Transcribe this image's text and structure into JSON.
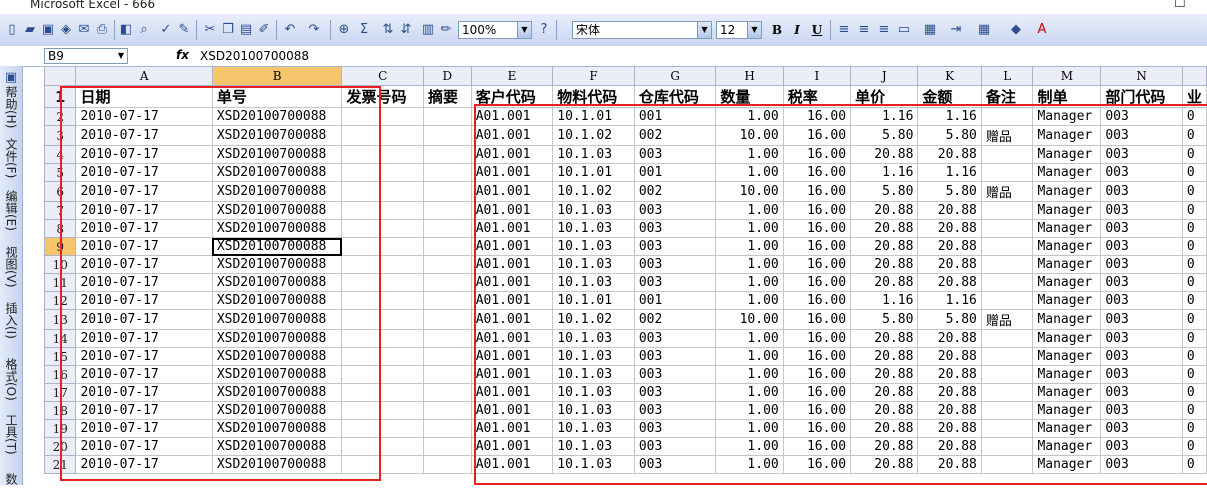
{
  "window": {
    "title": "Microsoft Excel - 666",
    "maximize_glyph": "☐"
  },
  "toolbar": {
    "zoom": "100%",
    "font_name": "宋体",
    "font_size": "12",
    "bold": "B",
    "italic": "I",
    "underline": "U"
  },
  "formula_bar": {
    "name_box": "B9",
    "fx": "fx",
    "content": "XSD20100700088"
  },
  "side_menu": [
    "帮助(H)",
    "文件(F)",
    "编辑(E)",
    "视图(V)",
    "插入(I)",
    "格式(O)",
    "工具(T)",
    "数据(D)"
  ],
  "sheet": {
    "columns": [
      "A",
      "B",
      "C",
      "D",
      "E",
      "F",
      "G",
      "H",
      "I",
      "J",
      "K",
      "L",
      "M",
      "N",
      ""
    ],
    "header_row": [
      "日期",
      "单号",
      "发票号码",
      "摘要",
      "客户代码",
      "物料代码",
      "仓库代码",
      "数量",
      "税率",
      "单价",
      "金额",
      "备注",
      "制单",
      "部门代码",
      "业"
    ],
    "rows": [
      [
        "2",
        "2010-07-17",
        "XSD20100700088",
        "",
        "",
        "A01.001",
        "10.1.01",
        "001",
        "1.00",
        "16.00",
        "1.16",
        "1.16",
        "",
        "Manager",
        "003",
        "0"
      ],
      [
        "3",
        "2010-07-17",
        "XSD20100700088",
        "",
        "",
        "A01.001",
        "10.1.02",
        "002",
        "10.00",
        "16.00",
        "5.80",
        "5.80",
        "赠品",
        "Manager",
        "003",
        "0"
      ],
      [
        "4",
        "2010-07-17",
        "XSD20100700088",
        "",
        "",
        "A01.001",
        "10.1.03",
        "003",
        "1.00",
        "16.00",
        "20.88",
        "20.88",
        "",
        "Manager",
        "003",
        "0"
      ],
      [
        "5",
        "2010-07-17",
        "XSD20100700088",
        "",
        "",
        "A01.001",
        "10.1.01",
        "001",
        "1.00",
        "16.00",
        "1.16",
        "1.16",
        "",
        "Manager",
        "003",
        "0"
      ],
      [
        "6",
        "2010-07-17",
        "XSD20100700088",
        "",
        "",
        "A01.001",
        "10.1.02",
        "002",
        "10.00",
        "16.00",
        "5.80",
        "5.80",
        "赠品",
        "Manager",
        "003",
        "0"
      ],
      [
        "7",
        "2010-07-17",
        "XSD20100700088",
        "",
        "",
        "A01.001",
        "10.1.03",
        "003",
        "1.00",
        "16.00",
        "20.88",
        "20.88",
        "",
        "Manager",
        "003",
        "0"
      ],
      [
        "8",
        "2010-07-17",
        "XSD20100700088",
        "",
        "",
        "A01.001",
        "10.1.03",
        "003",
        "1.00",
        "16.00",
        "20.88",
        "20.88",
        "",
        "Manager",
        "003",
        "0"
      ],
      [
        "9",
        "2010-07-17",
        "XSD20100700088",
        "",
        "",
        "A01.001",
        "10.1.03",
        "003",
        "1.00",
        "16.00",
        "20.88",
        "20.88",
        "",
        "Manager",
        "003",
        "0"
      ],
      [
        "10",
        "2010-07-17",
        "XSD20100700088",
        "",
        "",
        "A01.001",
        "10.1.03",
        "003",
        "1.00",
        "16.00",
        "20.88",
        "20.88",
        "",
        "Manager",
        "003",
        "0"
      ],
      [
        "11",
        "2010-07-17",
        "XSD20100700088",
        "",
        "",
        "A01.001",
        "10.1.03",
        "003",
        "1.00",
        "16.00",
        "20.88",
        "20.88",
        "",
        "Manager",
        "003",
        "0"
      ],
      [
        "12",
        "2010-07-17",
        "XSD20100700088",
        "",
        "",
        "A01.001",
        "10.1.01",
        "001",
        "1.00",
        "16.00",
        "1.16",
        "1.16",
        "",
        "Manager",
        "003",
        "0"
      ],
      [
        "13",
        "2010-07-17",
        "XSD20100700088",
        "",
        "",
        "A01.001",
        "10.1.02",
        "002",
        "10.00",
        "16.00",
        "5.80",
        "5.80",
        "赠品",
        "Manager",
        "003",
        "0"
      ],
      [
        "14",
        "2010-07-17",
        "XSD20100700088",
        "",
        "",
        "A01.001",
        "10.1.03",
        "003",
        "1.00",
        "16.00",
        "20.88",
        "20.88",
        "",
        "Manager",
        "003",
        "0"
      ],
      [
        "15",
        "2010-07-17",
        "XSD20100700088",
        "",
        "",
        "A01.001",
        "10.1.03",
        "003",
        "1.00",
        "16.00",
        "20.88",
        "20.88",
        "",
        "Manager",
        "003",
        "0"
      ],
      [
        "16",
        "2010-07-17",
        "XSD20100700088",
        "",
        "",
        "A01.001",
        "10.1.03",
        "003",
        "1.00",
        "16.00",
        "20.88",
        "20.88",
        "",
        "Manager",
        "003",
        "0"
      ],
      [
        "17",
        "2010-07-17",
        "XSD20100700088",
        "",
        "",
        "A01.001",
        "10.1.03",
        "003",
        "1.00",
        "16.00",
        "20.88",
        "20.88",
        "",
        "Manager",
        "003",
        "0"
      ],
      [
        "18",
        "2010-07-17",
        "XSD20100700088",
        "",
        "",
        "A01.001",
        "10.1.03",
        "003",
        "1.00",
        "16.00",
        "20.88",
        "20.88",
        "",
        "Manager",
        "003",
        "0"
      ],
      [
        "19",
        "2010-07-17",
        "XSD20100700088",
        "",
        "",
        "A01.001",
        "10.1.03",
        "003",
        "1.00",
        "16.00",
        "20.88",
        "20.88",
        "",
        "Manager",
        "003",
        "0"
      ],
      [
        "20",
        "2010-07-17",
        "XSD20100700088",
        "",
        "",
        "A01.001",
        "10.1.03",
        "003",
        "1.00",
        "16.00",
        "20.88",
        "20.88",
        "",
        "Manager",
        "003",
        "0"
      ],
      [
        "21",
        "2010-07-17",
        "XSD20100700088",
        "",
        "",
        "A01.001",
        "10.1.03",
        "003",
        "1.00",
        "16.00",
        "20.88",
        "20.88",
        "",
        "Manager",
        "003",
        "0"
      ]
    ]
  },
  "colors": {
    "selection_highlight": "#f7c56b",
    "annotation_red": "#e82020"
  }
}
